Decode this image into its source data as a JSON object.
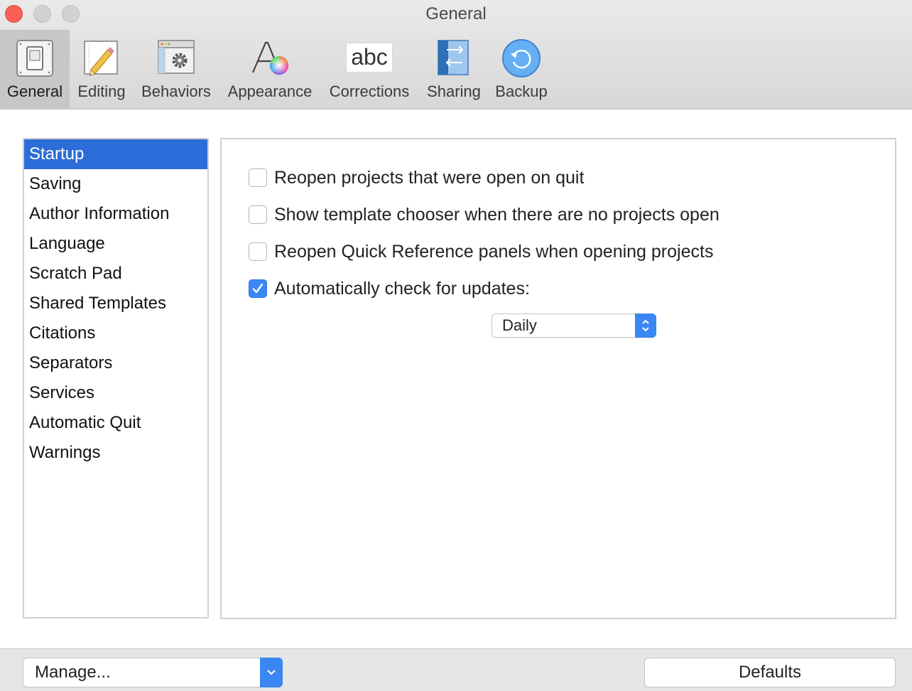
{
  "window": {
    "title": "General"
  },
  "toolbar": {
    "items": [
      {
        "label": "General",
        "icon": "switch-icon",
        "active": true
      },
      {
        "label": "Editing",
        "icon": "pencil-icon"
      },
      {
        "label": "Behaviors",
        "icon": "gear-window-icon"
      },
      {
        "label": "Appearance",
        "icon": "font-color-icon"
      },
      {
        "label": "Corrections",
        "icon": "abc-icon",
        "icon_text": "abc"
      },
      {
        "label": "Sharing",
        "icon": "sharing-icon"
      },
      {
        "label": "Backup",
        "icon": "backup-icon"
      }
    ]
  },
  "sidebar": {
    "items": [
      {
        "label": "Startup",
        "selected": true
      },
      {
        "label": "Saving"
      },
      {
        "label": "Author Information"
      },
      {
        "label": "Language"
      },
      {
        "label": "Scratch Pad"
      },
      {
        "label": "Shared Templates"
      },
      {
        "label": "Citations"
      },
      {
        "label": "Separators"
      },
      {
        "label": "Services"
      },
      {
        "label": "Automatic Quit"
      },
      {
        "label": "Warnings"
      }
    ]
  },
  "options": [
    {
      "label": "Reopen projects that were open on quit",
      "checked": false
    },
    {
      "label": "Show template chooser when there are no projects open",
      "checked": false
    },
    {
      "label": "Reopen Quick Reference panels when opening projects",
      "checked": false
    },
    {
      "label": "Automatically check for updates:",
      "checked": true
    }
  ],
  "update_frequency": {
    "value": "Daily"
  },
  "bottom": {
    "manage_label": "Manage...",
    "defaults_label": "Defaults"
  },
  "colors": {
    "accent": "#3b88f5",
    "selection": "#2d6dd9",
    "close": "#fc5f57"
  }
}
